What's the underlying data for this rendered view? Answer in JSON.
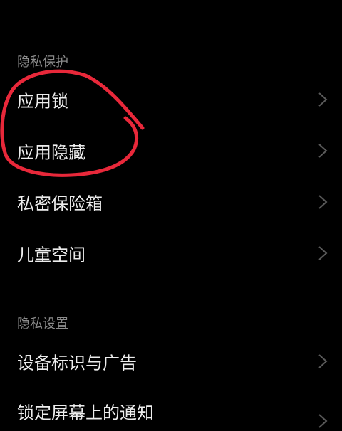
{
  "top_truncated_text": "",
  "sections": [
    {
      "header": "隐私保护",
      "items": [
        {
          "label": "应用锁"
        },
        {
          "label": "应用隐藏"
        },
        {
          "label": "私密保险箱"
        },
        {
          "label": "儿童空间"
        }
      ]
    },
    {
      "header": "隐私设置",
      "items": [
        {
          "label": "设备标识与广告"
        },
        {
          "label": "锁定屏幕上的通知"
        }
      ]
    }
  ],
  "annotation": {
    "shape": "hand-drawn-circle",
    "color": "#e8283a",
    "encloses": [
      "应用锁",
      "应用隐藏"
    ]
  },
  "colors": {
    "background": "#000000",
    "text_primary": "#ededed",
    "text_secondary": "#8c8c8c",
    "chevron": "#5a5a5a",
    "divider": "#1f1f1f"
  }
}
